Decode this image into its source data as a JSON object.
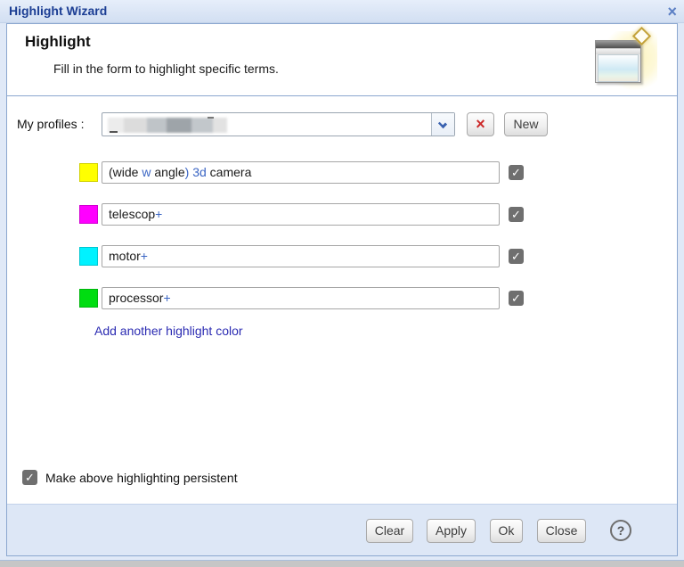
{
  "window": {
    "title": "Highlight Wizard"
  },
  "header": {
    "title": "Highlight",
    "subtitle": "Fill in the form to highlight specific terms."
  },
  "profiles": {
    "label": "My profiles :",
    "value_redacted": true,
    "new_button": "New"
  },
  "highlight_rows": [
    {
      "color": "#ffff00",
      "checked": true,
      "segments": [
        {
          "text": "(wide ",
          "style": "normal"
        },
        {
          "text": "w",
          "style": "accent"
        },
        {
          "text": " angle",
          "style": "normal"
        },
        {
          "text": ") ",
          "style": "accent"
        },
        {
          "text": "3d",
          "style": "accent"
        },
        {
          "text": " camera",
          "style": "normal"
        }
      ]
    },
    {
      "color": "#ff00ff",
      "checked": true,
      "segments": [
        {
          "text": "telescop",
          "style": "normal"
        },
        {
          "text": "+",
          "style": "accent"
        }
      ]
    },
    {
      "color": "#00f2ff",
      "checked": true,
      "segments": [
        {
          "text": "motor",
          "style": "normal"
        },
        {
          "text": "+",
          "style": "accent"
        }
      ]
    },
    {
      "color": "#00dd11",
      "checked": true,
      "segments": [
        {
          "text": "processor",
          "style": "normal"
        },
        {
          "text": "+",
          "style": "accent"
        }
      ]
    }
  ],
  "add_link": "Add another highlight color",
  "persistent_checkbox": {
    "label": "Make above highlighting persistent",
    "checked": true
  },
  "footer": {
    "buttons": [
      "Clear",
      "Apply",
      "Ok",
      "Close"
    ]
  },
  "glyphs": {
    "close": "×",
    "delete": "×",
    "check": "✓",
    "help": "?"
  },
  "colors": {
    "accent_text": "#3b66c4",
    "link": "#2b2bb2",
    "title_text": "#1c3e94"
  }
}
